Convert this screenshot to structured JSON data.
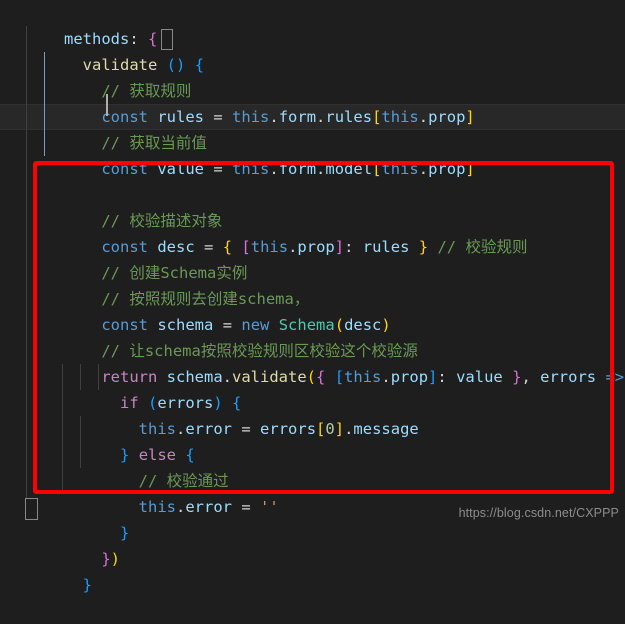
{
  "editor": {
    "language": "javascript",
    "theme": "Dark+ (VS Code dark)",
    "background_color": "#1e1e1e",
    "current_line_color": "#282828",
    "font_size_px": 15.5,
    "line_height_px": 26,
    "code_lines": [
      {
        "indent": 0,
        "text": "methods: {"
      },
      {
        "indent": 1,
        "text": "validate () {"
      },
      {
        "indent": 2,
        "text": "// 获取规则"
      },
      {
        "indent": 2,
        "text": "const rules = this.form.rules[this.prop]"
      },
      {
        "indent": 2,
        "text": "// 获取当前值"
      },
      {
        "indent": 2,
        "text": "const value = this.form.model[this.prop]"
      },
      {
        "indent": 2,
        "text": ""
      },
      {
        "indent": 2,
        "text": "// 校验描述对象"
      },
      {
        "indent": 2,
        "text": "const desc = { [this.prop]: rules } // 校验规则"
      },
      {
        "indent": 2,
        "text": "// 创建Schema实例"
      },
      {
        "indent": 2,
        "text": "// 按照规则去创建schema,"
      },
      {
        "indent": 2,
        "text": "const schema = new Schema(desc)"
      },
      {
        "indent": 2,
        "text": "// 让schema按照校验规则区校验这个校验源"
      },
      {
        "indent": 2,
        "text": "return schema.validate({ [this.prop]: value }, errors => {"
      },
      {
        "indent": 3,
        "text": "if (errors) {"
      },
      {
        "indent": 4,
        "text": "this.error = errors[0].message"
      },
      {
        "indent": 3,
        "text": "} else {"
      },
      {
        "indent": 4,
        "text": "// 校验通过"
      },
      {
        "indent": 4,
        "text": "this.error = ''"
      },
      {
        "indent": 3,
        "text": "}"
      },
      {
        "indent": 2,
        "text": "})"
      },
      {
        "indent": 0,
        "text": "}"
      }
    ],
    "current_line_index": 4,
    "cursor": {
      "line_index": 4,
      "column_text": "// 获取"
    }
  },
  "annotation": {
    "type": "red-rectangle",
    "color": "#fe0000",
    "covers_lines": "// 校验描述对象 … })",
    "border_width_px": 4
  },
  "watermark": {
    "text": "https://blog.csdn.net/CXPPP",
    "color": "#8c8c8c"
  },
  "colors": {
    "keyword_control": "#c586c0",
    "keyword_declaration": "#569cd6",
    "identifier": "#9cdcfe",
    "function": "#dcdcaa",
    "class": "#4ec9b0",
    "comment": "#6a9955",
    "string": "#ce9178",
    "bracket_1": "#ffd700",
    "bracket_2": "#da70d6",
    "bracket_3": "#179fff",
    "operator": "#d4d4d4",
    "indent_guide": "#404040",
    "indent_guide_active": "#7a9cc6",
    "cursor": "#aeafad"
  }
}
